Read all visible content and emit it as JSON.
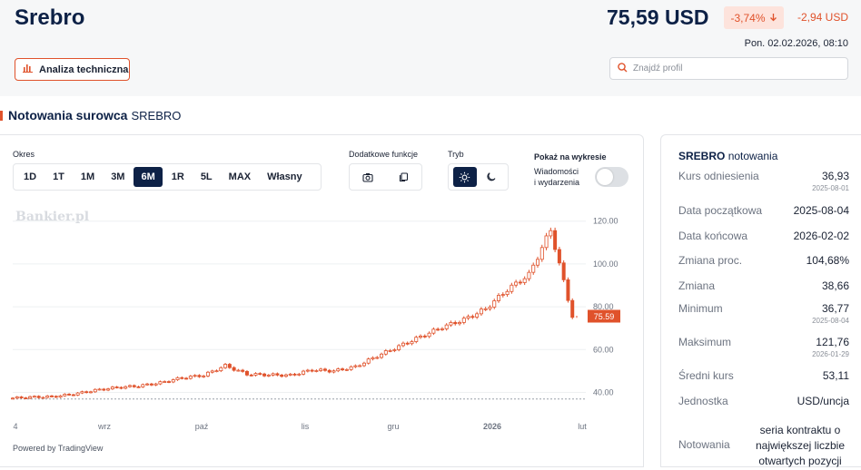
{
  "header": {
    "title": "Srebro",
    "price": "75,59 USD",
    "change_pct": "-3,74%",
    "change_abs": "-2,94 USD",
    "datetime": "Pon. 02.02.2026, 08:10",
    "technical_button": "Analiza techniczna",
    "search_placeholder": "Znajdź profil"
  },
  "section": {
    "title": "Notowania surowca",
    "subtitle": "SREBRO"
  },
  "controls": {
    "period_label": "Okres",
    "periods": [
      "1D",
      "1T",
      "1M",
      "3M",
      "6M",
      "1R",
      "5L",
      "MAX",
      "Własny"
    ],
    "active_period": "6M",
    "functions_label": "Dodatkowe funkcje",
    "mode_label": "Tryb",
    "show_label": "Pokaż na wykresie",
    "news_line1": "Wiadomości",
    "news_line2": "i wydarzenia"
  },
  "watermark": "Bankier.pl",
  "powered_by": "Powered by TradingView",
  "colors": {
    "accent": "#e0522b",
    "navy": "#0d2146",
    "down": "#e0522b"
  },
  "chart_data": {
    "type": "candlestick",
    "x_labels": [
      "4",
      "wrz",
      "paź",
      "lis",
      "gru",
      "2026",
      "lut"
    ],
    "y_ticks": [
      "40.00",
      "60.00",
      "80.00",
      "100.00",
      "120.00"
    ],
    "ylim": [
      33,
      122
    ],
    "last_price_label": "75.59",
    "last_price": 75.59,
    "reference_level": 36.93,
    "x": [
      "2025-08-04",
      "2025-08-11",
      "2025-08-18",
      "2025-08-25",
      "2025-09-01",
      "2025-09-08",
      "2025-09-15",
      "2025-09-22",
      "2025-09-29",
      "2025-10-06",
      "2025-10-13",
      "2025-10-20",
      "2025-10-27",
      "2025-11-03",
      "2025-11-10",
      "2025-11-17",
      "2025-11-24",
      "2025-12-01",
      "2025-12-08",
      "2025-12-15",
      "2025-12-22",
      "2025-12-29",
      "2026-01-05",
      "2026-01-12",
      "2026-01-19",
      "2026-01-26",
      "2026-02-02"
    ],
    "series": [
      {
        "name": "close",
        "values": [
          37.2,
          37.8,
          38.0,
          39.2,
          41.0,
          42.3,
          43.0,
          44.5,
          46.8,
          48.0,
          52.5,
          48.5,
          48.2,
          48.0,
          50.5,
          50.0,
          52.0,
          57.0,
          61.5,
          66.0,
          70.5,
          74.0,
          79.0,
          88.0,
          95.0,
          116.0,
          75.59
        ]
      }
    ]
  },
  "stats": {
    "title": "SREBRO",
    "title_sub": "notowania",
    "rows": [
      {
        "k": "Kurs odniesienia",
        "v": "36,93",
        "d": "2025-08-01"
      },
      {
        "k": "Data początkowa",
        "v": "2025-08-04"
      },
      {
        "k": "Data końcowa",
        "v": "2026-02-02"
      },
      {
        "k": "Zmiana proc.",
        "v": "104,68%"
      },
      {
        "k": "Zmiana",
        "v": "38,66"
      },
      {
        "k": "Minimum",
        "v": "36,77",
        "d": "2025-08-04"
      },
      {
        "k": "Maksimum",
        "v": "121,76",
        "d": "2026-01-29"
      },
      {
        "k": "Średni kurs",
        "v": "53,11"
      },
      {
        "k": "Jednostka",
        "v": "USD/uncja"
      }
    ],
    "listing_label": "Notowania",
    "listing_lines": [
      "seria kontraktu o",
      "największej liczbie",
      "otwartych pozycji"
    ]
  }
}
